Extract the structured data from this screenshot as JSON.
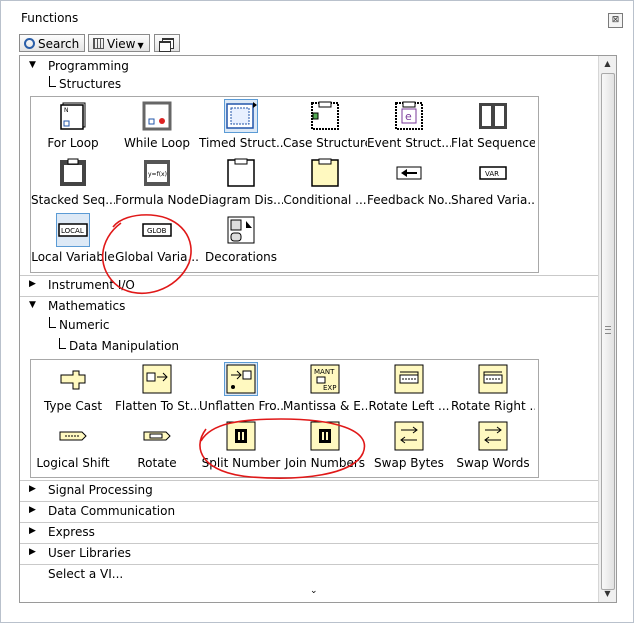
{
  "window": {
    "title": "Functions"
  },
  "toolbar": {
    "search_label": "Search",
    "view_label": "View"
  },
  "tree": {
    "programming": "Programming",
    "structures": "Structures",
    "instrument_io": "Instrument I/O",
    "mathematics": "Mathematics",
    "numeric": "Numeric",
    "data_manipulation": "Data Manipulation",
    "signal_processing": "Signal Processing",
    "data_communication": "Data Communication",
    "express": "Express",
    "user_libraries": "User Libraries",
    "select_vi": "Select a VI..."
  },
  "structures_palette": [
    {
      "label": "For Loop",
      "icon": "for-loop-icon"
    },
    {
      "label": "While Loop",
      "icon": "while-loop-icon"
    },
    {
      "label": "Timed Struct...",
      "icon": "timed-structure-icon"
    },
    {
      "label": "Case Structure",
      "icon": "case-structure-icon"
    },
    {
      "label": "Event Struct...",
      "icon": "event-structure-icon"
    },
    {
      "label": "Flat Sequence",
      "icon": "flat-sequence-icon"
    },
    {
      "label": "Stacked Seq...",
      "icon": "stacked-sequence-icon"
    },
    {
      "label": "Formula Node",
      "icon": "formula-node-icon"
    },
    {
      "label": "Diagram Dis...",
      "icon": "diagram-disable-icon"
    },
    {
      "label": "Conditional ...",
      "icon": "conditional-disable-icon"
    },
    {
      "label": "Feedback No...",
      "icon": "feedback-node-icon"
    },
    {
      "label": "Shared Varia...",
      "icon": "shared-variable-icon"
    },
    {
      "label": "Local Variable",
      "icon": "local-variable-icon"
    },
    {
      "label": "Global Varia...",
      "icon": "global-variable-icon"
    },
    {
      "label": "Decorations",
      "icon": "decorations-icon"
    }
  ],
  "icon_text": {
    "local": "LOCAL",
    "glob": "GLOB",
    "var": "VAR",
    "mant": "MANT",
    "exp": "EXP",
    "formula": "y=f(x)",
    "e": "e"
  },
  "data_manip_palette": [
    {
      "label": "Type Cast",
      "icon": "type-cast-icon"
    },
    {
      "label": "Flatten To St...",
      "icon": "flatten-to-string-icon"
    },
    {
      "label": "Unflatten Fro...",
      "icon": "unflatten-from-string-icon"
    },
    {
      "label": "Mantissa & E...",
      "icon": "mantissa-exponent-icon"
    },
    {
      "label": "Rotate Left ...",
      "icon": "rotate-left-icon"
    },
    {
      "label": "Rotate Right ...",
      "icon": "rotate-right-icon"
    },
    {
      "label": "Logical Shift",
      "icon": "logical-shift-icon"
    },
    {
      "label": "Rotate",
      "icon": "rotate-icon"
    },
    {
      "label": "Split Number",
      "icon": "split-number-icon"
    },
    {
      "label": "Join Numbers",
      "icon": "join-numbers-icon"
    },
    {
      "label": "Swap Bytes",
      "icon": "swap-bytes-icon"
    },
    {
      "label": "Swap Words",
      "icon": "swap-words-icon"
    }
  ],
  "colors": {
    "annotation": "#e01818",
    "selection": "#5b9bd5",
    "note_yellow": "#fff9c0"
  }
}
